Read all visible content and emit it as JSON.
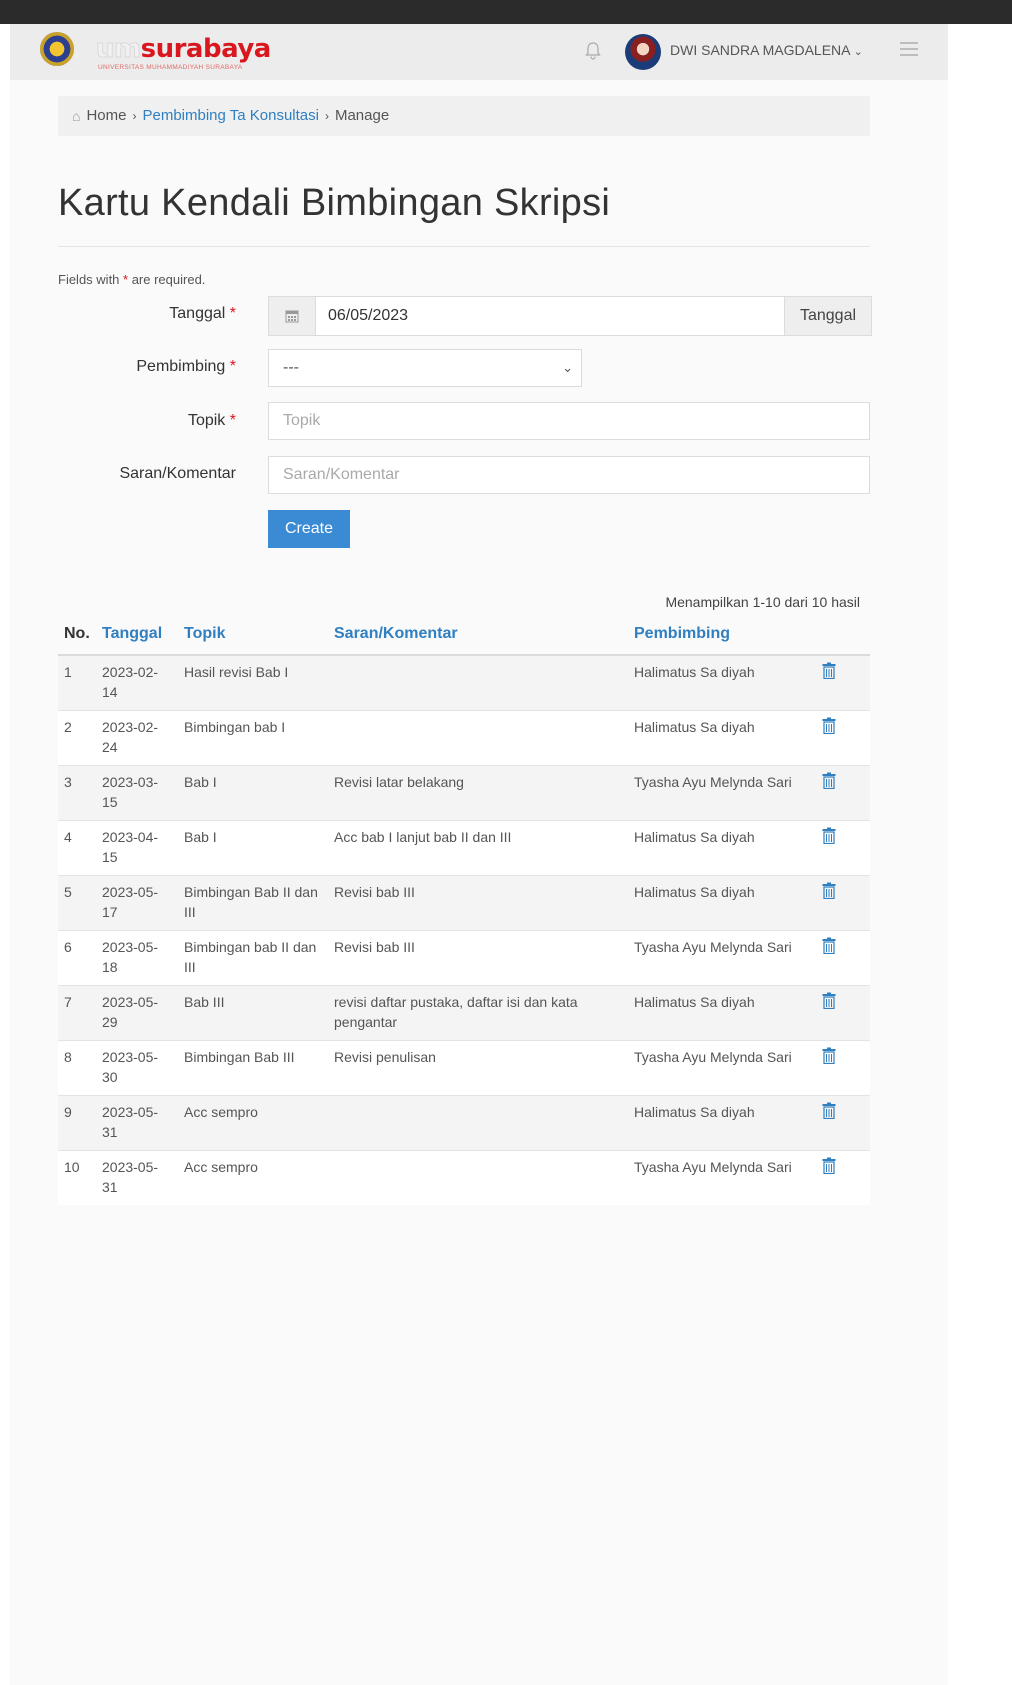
{
  "header": {
    "logo_um": "um",
    "logo_surabaya": "surabaya",
    "logo_sub": "Universitas Muhammadiyah Surabaya",
    "username": "DWI SANDRA MAGDALENA"
  },
  "breadcrumb": {
    "home": "Home",
    "link": "Pembimbing Ta Konsultasi",
    "current": "Manage",
    "separator": "›"
  },
  "page": {
    "title": "Kartu Kendali Bimbingan Skripsi",
    "required_note_prefix": "Fields with ",
    "required_note_star": "*",
    "required_note_suffix": " are required."
  },
  "form": {
    "tanggal_label": "Tanggal",
    "tanggal_value": "06/05/2023",
    "tanggal_addon": "Tanggal",
    "pembimbing_label": "Pembimbing",
    "pembimbing_value": "---",
    "topik_label": "Topik",
    "topik_placeholder": "Topik",
    "saran_label": "Saran/Komentar",
    "saran_placeholder": "Saran/Komentar",
    "required_star": "*",
    "create_button": "Create"
  },
  "table": {
    "summary": "Menampilkan 1-10 dari 10 hasil",
    "headers": {
      "no": "No.",
      "tanggal": "Tanggal",
      "topik": "Topik",
      "saran": "Saran/Komentar",
      "pembimbing": "Pembimbing"
    },
    "rows": [
      {
        "no": "1",
        "tanggal": "2023-02-14",
        "topik": "Hasil revisi Bab I",
        "saran": "",
        "pembimbing": "Halimatus Sa diyah"
      },
      {
        "no": "2",
        "tanggal": "2023-02-24",
        "topik": "Bimbingan bab I",
        "saran": "",
        "pembimbing": "Halimatus Sa diyah"
      },
      {
        "no": "3",
        "tanggal": "2023-03-15",
        "topik": "Bab I",
        "saran": "Revisi latar belakang",
        "pembimbing": "Tyasha Ayu Melynda Sari"
      },
      {
        "no": "4",
        "tanggal": "2023-04-15",
        "topik": "Bab I",
        "saran": "Acc bab I lanjut bab II dan III",
        "pembimbing": "Halimatus Sa diyah"
      },
      {
        "no": "5",
        "tanggal": "2023-05-17",
        "topik": "Bimbingan Bab II dan III",
        "saran": "Revisi bab III",
        "pembimbing": "Halimatus Sa diyah"
      },
      {
        "no": "6",
        "tanggal": "2023-05-18",
        "topik": "Bimbingan bab II dan III",
        "saran": "Revisi bab III",
        "pembimbing": "Tyasha Ayu Melynda Sari"
      },
      {
        "no": "7",
        "tanggal": "2023-05-29",
        "topik": "Bab III",
        "saran": "revisi daftar pustaka, daftar isi dan kata pengantar",
        "pembimbing": "Halimatus Sa diyah"
      },
      {
        "no": "8",
        "tanggal": "2023-05-30",
        "topik": "Bimbingan Bab III",
        "saran": "Revisi penulisan",
        "pembimbing": "Tyasha Ayu Melynda Sari"
      },
      {
        "no": "9",
        "tanggal": "2023-05-31",
        "topik": "Acc sempro",
        "saran": "",
        "pembimbing": "Halimatus Sa diyah"
      },
      {
        "no": "10",
        "tanggal": "2023-05-31",
        "topik": "Acc sempro",
        "saran": "",
        "pembimbing": "Tyasha Ayu Melynda Sari"
      }
    ]
  },
  "icons": {
    "home": "home-icon",
    "calendar": "calendar-icon",
    "bell": "bell-icon",
    "trash": "trash-icon",
    "menu": "hamburger-menu-icon"
  },
  "colors": {
    "brand_red": "#d8171f",
    "link_blue": "#2f7fc1",
    "button_blue": "#3a8bd3"
  }
}
